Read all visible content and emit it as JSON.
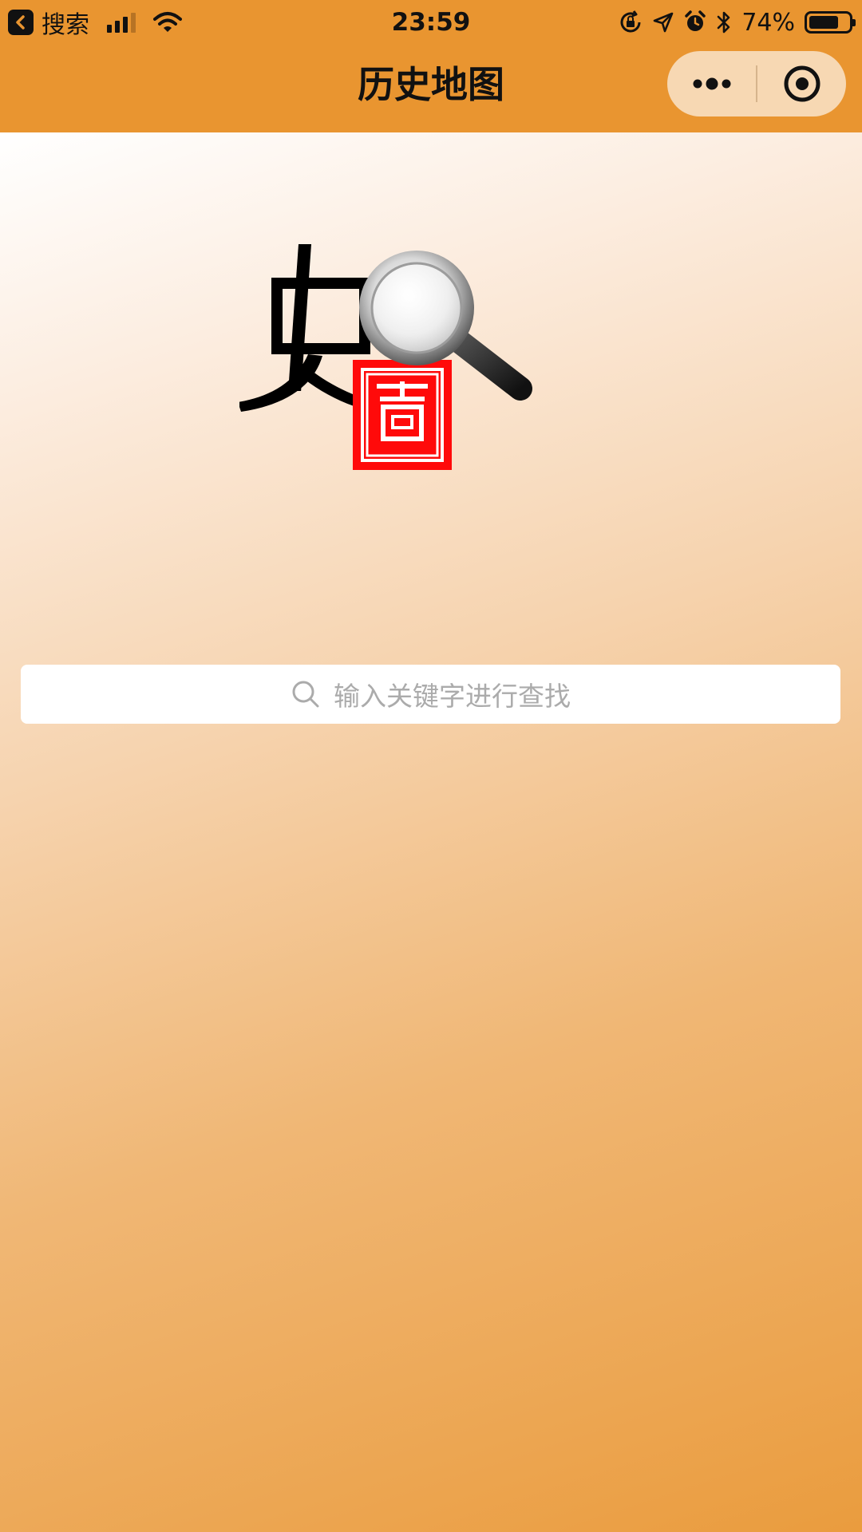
{
  "status_bar": {
    "back_app_label": "搜索",
    "time": "23:59",
    "battery_percent": "74%",
    "battery_level": 0.74,
    "icons": [
      "back-arrow-icon",
      "cellular-signal-icon",
      "wifi-icon",
      "orientation-lock-icon",
      "location-arrow-icon",
      "alarm-icon",
      "bluetooth-icon",
      "battery-icon"
    ]
  },
  "nav_bar": {
    "title": "历史地图",
    "capsule": {
      "more_icon": "more-dots-icon",
      "close_icon": "target-circle-icon"
    }
  },
  "logo": {
    "characters": [
      "史",
      "图"
    ],
    "icon": "magnifier-icon"
  },
  "search": {
    "placeholder": "输入关键字进行查找",
    "icon": "search-icon"
  },
  "colors": {
    "bar_orange": "#E99530",
    "capsule_bg": "#F7D8B3",
    "logo_red": "#FF0A0A",
    "placeholder_gray": "#ABABAB"
  }
}
